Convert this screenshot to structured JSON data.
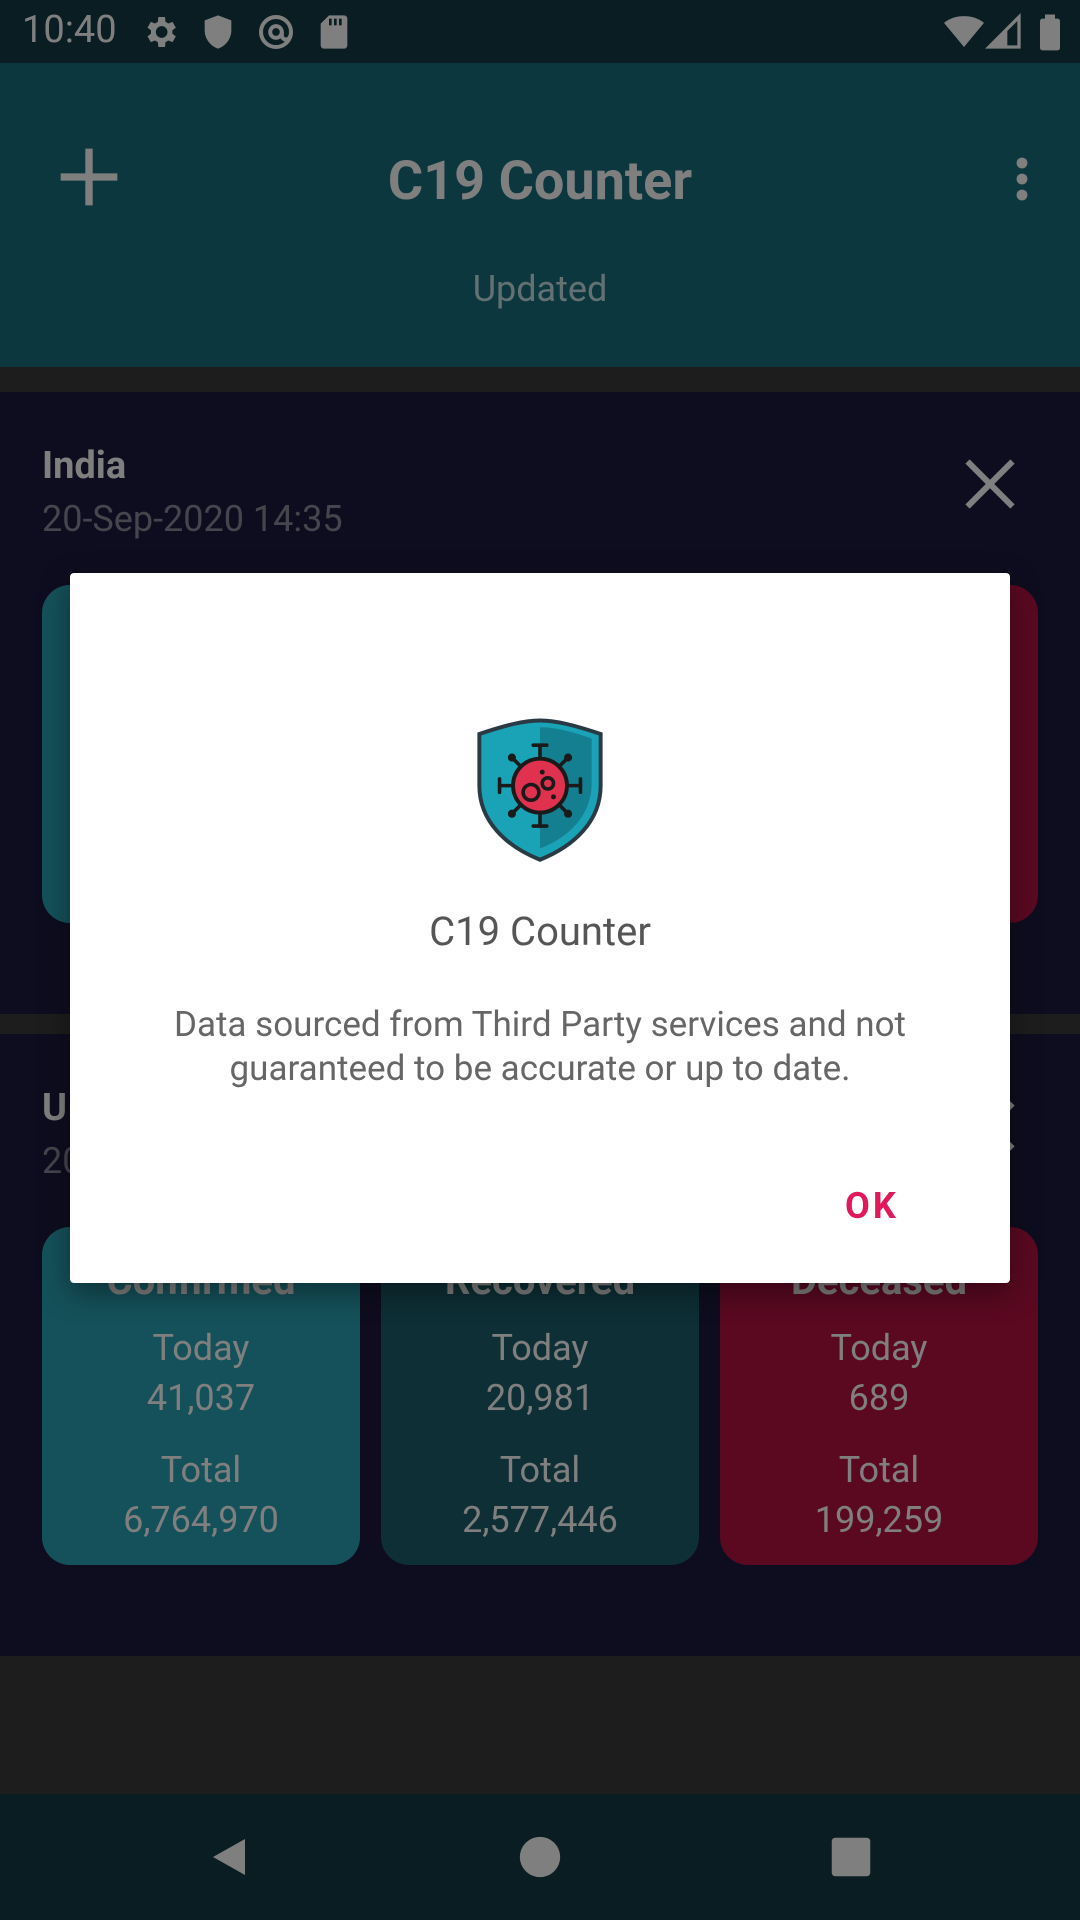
{
  "status_bar": {
    "time": "10:40",
    "icons": [
      "gear-icon",
      "shield-icon",
      "at-icon",
      "sd-card-icon",
      "wifi-icon",
      "signal-icon",
      "battery-icon"
    ]
  },
  "app_bar": {
    "title": "C19 Counter",
    "subtitle": "Updated",
    "add_icon": "plus-icon",
    "menu_icon": "overflow-menu-icon"
  },
  "cards": [
    {
      "country": "India",
      "date": "20-Sep-2020 14:35",
      "stats": []
    },
    {
      "country": "U",
      "date": "20",
      "stats": [
        {
          "head": "Confirmed",
          "today_label": "Today",
          "today": "41,037",
          "total_label": "Total",
          "total": "6,764,970"
        },
        {
          "head": "Recovered",
          "today_label": "Today",
          "today": "20,981",
          "total_label": "Total",
          "total": "2,577,446"
        },
        {
          "head": "Deceased",
          "today_label": "Today",
          "today": "689",
          "total_label": "Total",
          "total": "199,259"
        }
      ]
    }
  ],
  "dialog": {
    "title": "C19 Counter",
    "message": "Data sourced from Third Party services and not guaranteed to be accurate or up to date.",
    "ok_label": "OK"
  },
  "colors": {
    "status_bar": "#143a45",
    "app_bar": "#1b6f7e",
    "card_background": "#1d1a3f",
    "confirmed": "#2aa2b5",
    "recovered": "#1b5f6a",
    "deceased": "#b41243",
    "accent": "#e0195b"
  }
}
